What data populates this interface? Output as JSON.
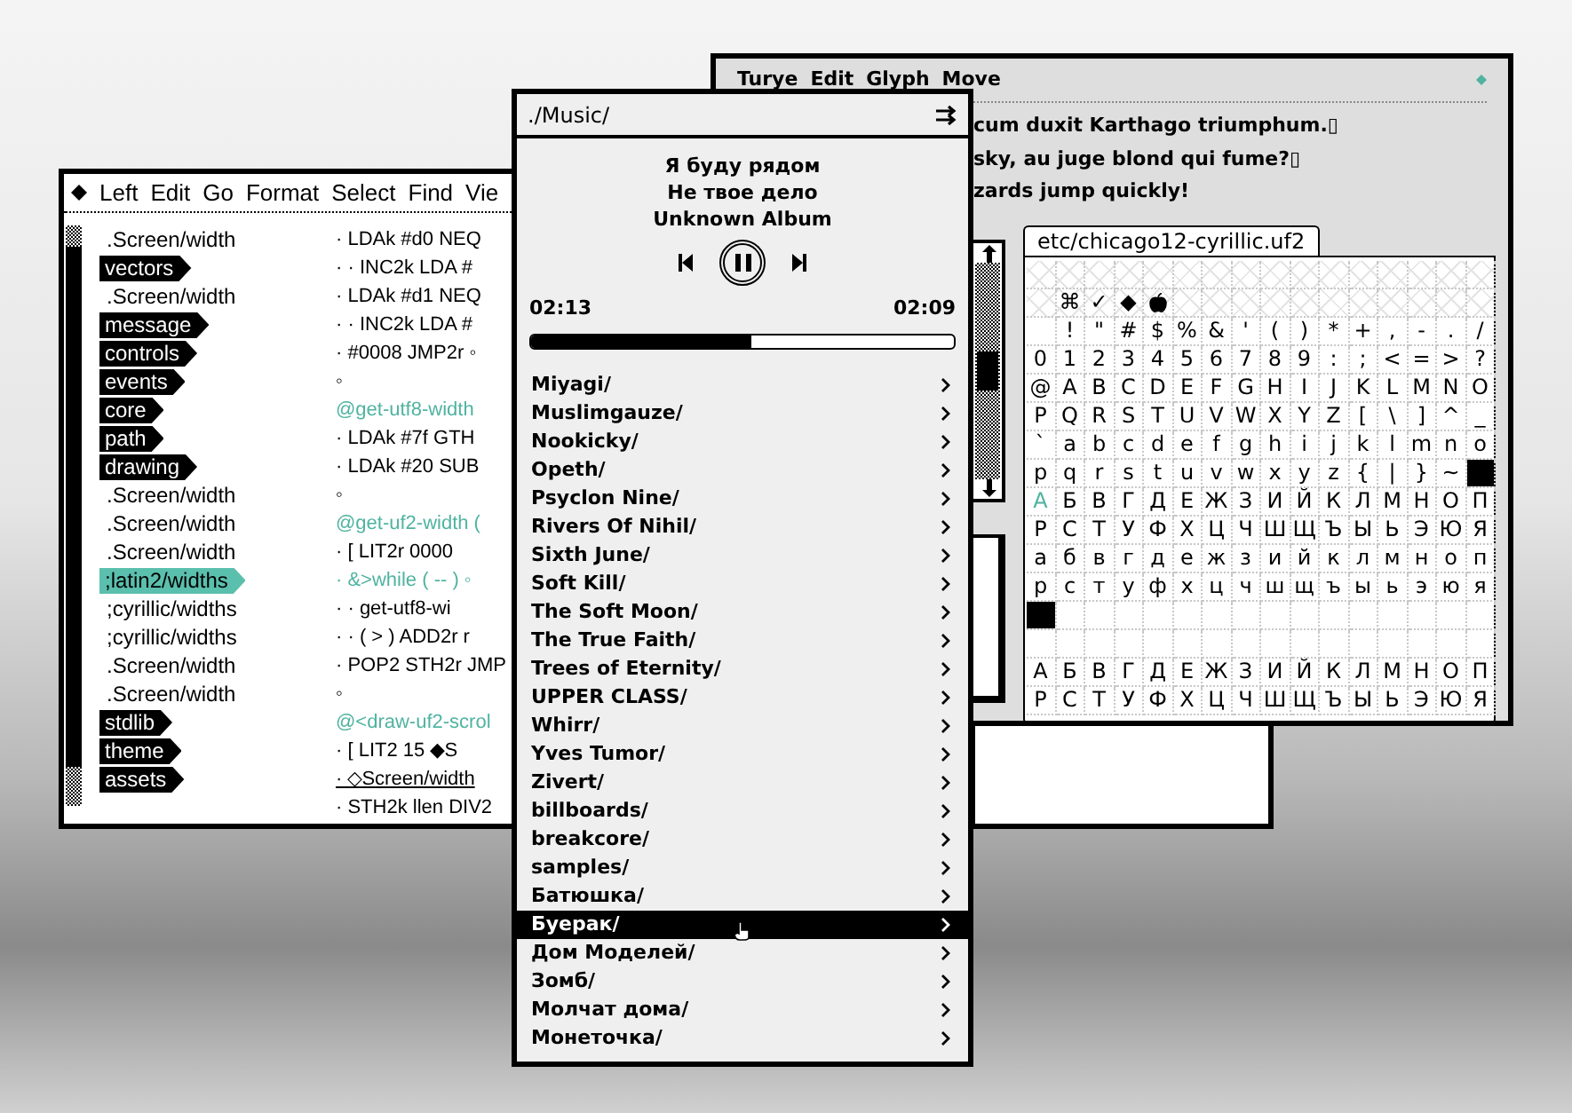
{
  "editor": {
    "menu": [
      "Left",
      "Edit",
      "Go",
      "Format",
      "Select",
      "Find",
      "Vie"
    ],
    "sidebar": {
      "items": [
        {
          "text": ".Screen/width",
          "kind": "plain",
          "selected": false
        },
        {
          "text": "vectors",
          "kind": "tag",
          "selected": false
        },
        {
          "text": ".Screen/width",
          "kind": "plain",
          "selected": false
        },
        {
          "text": "message",
          "kind": "tag",
          "selected": false
        },
        {
          "text": "controls",
          "kind": "tag",
          "selected": false
        },
        {
          "text": "events",
          "kind": "tag",
          "selected": false
        },
        {
          "text": "core",
          "kind": "tag",
          "selected": false
        },
        {
          "text": "path",
          "kind": "tag",
          "selected": false
        },
        {
          "text": "drawing",
          "kind": "tag",
          "selected": false
        },
        {
          "text": ".Screen/width",
          "kind": "plain",
          "selected": false
        },
        {
          "text": ".Screen/width",
          "kind": "plain",
          "selected": false
        },
        {
          "text": ".Screen/width",
          "kind": "plain",
          "selected": false
        },
        {
          "text": ";latin2/widths",
          "kind": "tag",
          "selected": true
        },
        {
          "text": ";cyrillic/widths",
          "kind": "plain",
          "selected": false
        },
        {
          "text": ";cyrillic/widths",
          "kind": "plain",
          "selected": false
        },
        {
          "text": ".Screen/width",
          "kind": "plain",
          "selected": false
        },
        {
          "text": ".Screen/width",
          "kind": "plain",
          "selected": false
        },
        {
          "text": "stdlib",
          "kind": "tag",
          "selected": false
        },
        {
          "text": "theme",
          "kind": "tag",
          "selected": false
        },
        {
          "text": "assets",
          "kind": "tag",
          "selected": false
        }
      ]
    },
    "code": [
      {
        "text": "· LDAk #d0 NEQ",
        "kind": "code"
      },
      {
        "text": "· · INC2k LDA #",
        "kind": "code"
      },
      {
        "text": "· LDAk #d1 NEQ",
        "kind": "code"
      },
      {
        "text": "· · INC2k LDA #",
        "kind": "code"
      },
      {
        "text": "· #0008 JMP2r ◦",
        "kind": "code"
      },
      {
        "text": "◦",
        "kind": "code"
      },
      {
        "text": "@get-utf8-width",
        "kind": "label"
      },
      {
        "text": "· LDAk #7f GTH",
        "kind": "code"
      },
      {
        "text": "· LDAk #20 SUB",
        "kind": "code"
      },
      {
        "text": "◦",
        "kind": "code"
      },
      {
        "text": "@get-uf2-width (",
        "kind": "label"
      },
      {
        "text": "· [ LIT2r 0000",
        "kind": "code"
      },
      {
        "text": "· &>while ( -- ) ◦",
        "kind": "label"
      },
      {
        "text": "· · get-utf8-wi",
        "kind": "code"
      },
      {
        "text": "· · ( > ) ADD2r r",
        "kind": "code"
      },
      {
        "text": "· POP2 STH2r JMP",
        "kind": "code"
      },
      {
        "text": "◦",
        "kind": "code"
      },
      {
        "text": "@<draw-uf2-scrol",
        "kind": "label"
      },
      {
        "text": "· [ LIT2 15 ◆S",
        "kind": "code"
      },
      {
        "text": "· ◇Screen/width",
        "kind": "link"
      },
      {
        "text": "· STH2k llen DIV2",
        "kind": "code"
      }
    ]
  },
  "player": {
    "path": "./Music/",
    "track": {
      "title": "Я буду рядом",
      "artist": "Не твое дело",
      "album": "Unknown Album"
    },
    "playing": true,
    "elapsed": "02:13",
    "remaining": "02:09",
    "level": 0.52,
    "folders": [
      {
        "name": "Miyagi/",
        "selected": false
      },
      {
        "name": "Muslimgauze/",
        "selected": false
      },
      {
        "name": "Nookicky/",
        "selected": false
      },
      {
        "name": "Opeth/",
        "selected": false
      },
      {
        "name": "Psyclon Nine/",
        "selected": false
      },
      {
        "name": "Rivers Of Nihil/",
        "selected": false
      },
      {
        "name": "Sixth June/",
        "selected": false
      },
      {
        "name": "Soft Kill/",
        "selected": false
      },
      {
        "name": "The Soft Moon/",
        "selected": false
      },
      {
        "name": "The True Faith/",
        "selected": false
      },
      {
        "name": "Trees of Eternity/",
        "selected": false
      },
      {
        "name": "UPPER CLASS/",
        "selected": false
      },
      {
        "name": "Whirr/",
        "selected": false
      },
      {
        "name": "Yves Tumor/",
        "selected": false
      },
      {
        "name": "Zivert/",
        "selected": false
      },
      {
        "name": "billboards/",
        "selected": false
      },
      {
        "name": "breakcore/",
        "selected": false
      },
      {
        "name": "samples/",
        "selected": false
      },
      {
        "name": "Батюшка/",
        "selected": false
      },
      {
        "name": "Буерак/",
        "selected": true
      },
      {
        "name": "Дом Моделей/",
        "selected": false
      },
      {
        "name": "Зомб/",
        "selected": false
      },
      {
        "name": "Молчат дома/",
        "selected": false
      },
      {
        "name": "Монеточка/",
        "selected": false
      }
    ]
  },
  "font_editor": {
    "menu": [
      "Turye",
      "Edit",
      "Glyph",
      "Move"
    ],
    "sample_lines": [
      "cum duxit Karthago triumphum.▯",
      "sky, au juge blond qui fume?▯",
      "zards jump quickly!"
    ],
    "tab": "etc/chicago12-cyrillic.uf2",
    "glyph_rows": [
      {
        "hatched": true
      },
      {
        "hatched": true,
        "cells": [
          null,
          "⌘",
          "✓",
          "◆",
          {
            "kind": "apple"
          }
        ]
      },
      {
        "hatched": false,
        "cells": [
          null,
          "!",
          "\"",
          "#",
          "$",
          "%",
          "&",
          "'",
          "(",
          ")",
          "*",
          "+",
          ",",
          "-",
          ".",
          "/"
        ]
      },
      {
        "hatched": false,
        "cells": [
          "0",
          "1",
          "2",
          "3",
          "4",
          "5",
          "6",
          "7",
          "8",
          "9",
          ":",
          ";",
          "<",
          "=",
          ">",
          "?"
        ]
      },
      {
        "hatched": false,
        "cells": [
          "@",
          "A",
          "B",
          "C",
          "D",
          "E",
          "F",
          "G",
          "H",
          "I",
          "J",
          "K",
          "L",
          "M",
          "N",
          "O"
        ]
      },
      {
        "hatched": false,
        "cells": [
          "P",
          "Q",
          "R",
          "S",
          "T",
          "U",
          "V",
          "W",
          "X",
          "Y",
          "Z",
          "[",
          "\\",
          "]",
          "^",
          "_"
        ]
      },
      {
        "hatched": false,
        "cells": [
          "`",
          "a",
          "b",
          "c",
          "d",
          "e",
          "f",
          "g",
          "h",
          "i",
          "j",
          "k",
          "l",
          "m",
          "n",
          "o"
        ]
      },
      {
        "hatched": false,
        "cells": [
          "p",
          "q",
          "r",
          "s",
          "t",
          "u",
          "v",
          "w",
          "x",
          "y",
          "z",
          "{",
          "|",
          "}",
          "~",
          {
            "kind": "block"
          }
        ]
      },
      {
        "hatched": false,
        "cells": [
          {
            "kind": "highlight",
            "glyph": "А"
          },
          "Б",
          "В",
          "Г",
          "Д",
          "Е",
          "Ж",
          "З",
          "И",
          "Й",
          "К",
          "Л",
          "М",
          "Н",
          "О",
          "П"
        ]
      },
      {
        "hatched": false,
        "cells": [
          "Р",
          "С",
          "Т",
          "У",
          "Ф",
          "Х",
          "Ц",
          "Ч",
          "Ш",
          "Щ",
          "Ъ",
          "Ы",
          "Ь",
          "Э",
          "Ю",
          "Я"
        ]
      },
      {
        "hatched": false,
        "cells": [
          "а",
          "б",
          "в",
          "г",
          "д",
          "е",
          "ж",
          "з",
          "и",
          "й",
          "к",
          "л",
          "м",
          "н",
          "о",
          "п"
        ]
      },
      {
        "hatched": false,
        "cells": [
          "р",
          "с",
          "т",
          "у",
          "ф",
          "х",
          "ц",
          "ч",
          "ш",
          "щ",
          "ъ",
          "ы",
          "ь",
          "э",
          "ю",
          "я"
        ]
      },
      {
        "hatched": false,
        "cells": [
          {
            "kind": "block"
          }
        ]
      },
      {
        "hatched": false
      },
      {
        "hatched": false,
        "cells": [
          "А",
          "Б",
          "В",
          "Г",
          "Д",
          "Е",
          "Ж",
          "З",
          "И",
          "Й",
          "К",
          "Л",
          "М",
          "Н",
          "О",
          "П"
        ]
      },
      {
        "hatched": false,
        "cells": [
          "Р",
          "С",
          "Т",
          "У",
          "Ф",
          "Х",
          "Ц",
          "Ч",
          "Ш",
          "Щ",
          "Ъ",
          "Ы",
          "Ь",
          "Э",
          "Ю",
          "Я"
        ]
      }
    ]
  }
}
